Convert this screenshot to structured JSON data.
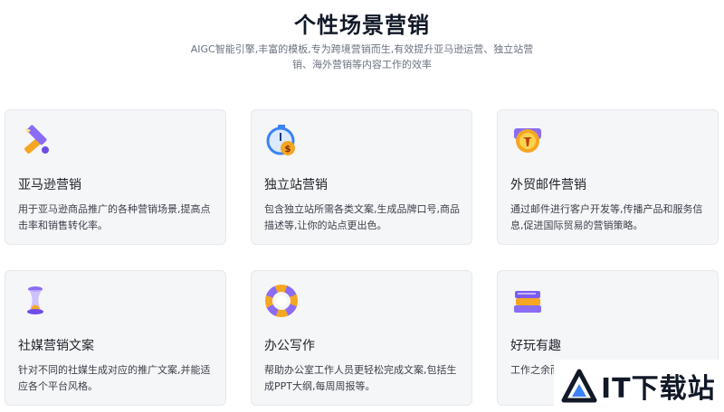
{
  "header": {
    "title": "个性场景营销",
    "subtitle": "AIGC智能引擎,丰富的模板,专为跨境营销而生,有效提升亚马逊运营、独立站营销、海外营销等内容工作的效率"
  },
  "cards": [
    {
      "icon": "pencil-ruler-icon",
      "title": "亚马逊营销",
      "desc": "用于亚马逊商品推广的各种营销场景,提高点击率和销售转化率。"
    },
    {
      "icon": "stopwatch-coin-icon",
      "title": "独立站营销",
      "desc": "包含独立站所需各类文案,生成品牌口号,商品描述等,让你的站点更出色。"
    },
    {
      "icon": "mail-badge-icon",
      "title": "外贸邮件营销",
      "desc": "通过邮件进行客户开发等,传播产品和服务信息,促进国际贸易的营销策略。"
    },
    {
      "icon": "hourglass-icon",
      "title": "社媒营销文案",
      "desc": "针对不同的社媒生成对应的推广文案,并能适应各个平台风格。"
    },
    {
      "icon": "lifebuoy-icon",
      "title": "办公写作",
      "desc": "帮助办公室工作人员更轻松完成文案,包括生成PPT大纲,每周周报等。"
    },
    {
      "icon": "books-stack-icon",
      "title": "好玩有趣",
      "desc": "工作之余而且含有"
    }
  ],
  "watermark": {
    "text": "IT下载站"
  },
  "colors": {
    "card_bg": "#f5f6f8",
    "accent_purple": "#7c5cf0",
    "accent_orange": "#f5a623",
    "accent_blue": "#3b82f6"
  }
}
